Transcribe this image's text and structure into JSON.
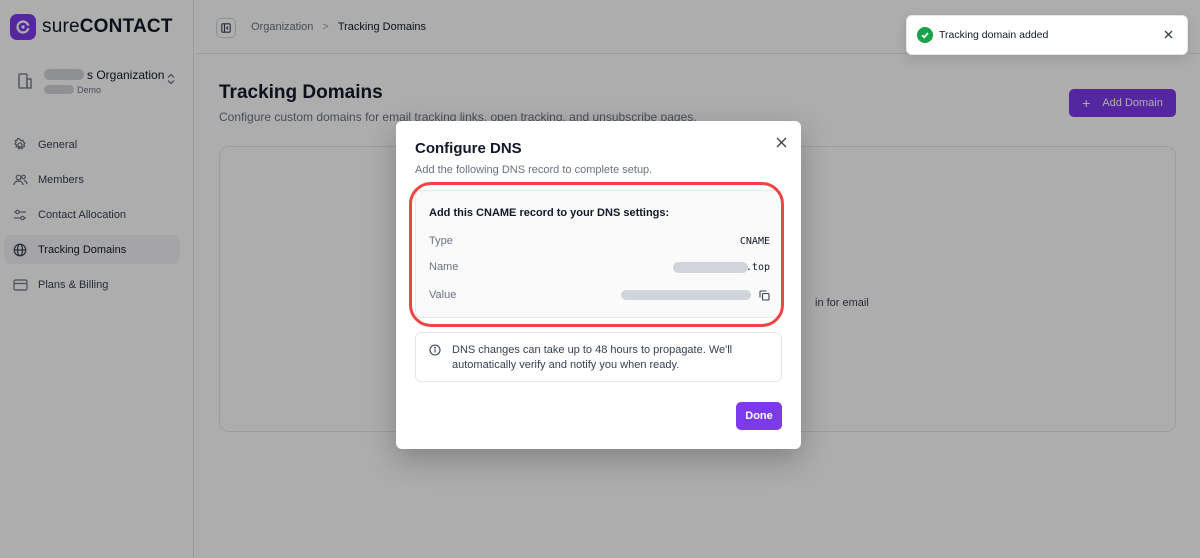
{
  "app": {
    "logo_text_light": "sure",
    "logo_text_bold": "CONTACT",
    "accent_color": "#7c3aed"
  },
  "sidebar": {
    "org_name_suffix": "s Organization",
    "org_subtitle_suffix": "Demo",
    "items": [
      {
        "label": "General",
        "icon": "gear-icon"
      },
      {
        "label": "Members",
        "icon": "users-icon"
      },
      {
        "label": "Contact Allocation",
        "icon": "sliders-icon"
      },
      {
        "label": "Tracking Domains",
        "icon": "globe-icon",
        "active": true
      },
      {
        "label": "Plans & Billing",
        "icon": "credit-card-icon"
      }
    ]
  },
  "topbar": {
    "breadcrumbs": [
      "Organization",
      "Tracking Domains"
    ],
    "separator": ">"
  },
  "page": {
    "title": "Tracking Domains",
    "subtitle": "Configure custom domains for email tracking links, open tracking, and unsubscribe pages.",
    "add_button_label": "Add Domain",
    "card_text_fragment": "in for email"
  },
  "toast": {
    "message": "Tracking domain added",
    "status_color": "#16a34a"
  },
  "modal": {
    "title": "Configure DNS",
    "subtitle": "Add the following DNS record to complete setup.",
    "record_heading": "Add this CNAME record to your DNS settings:",
    "rows": [
      {
        "label": "Type",
        "value": "CNAME"
      },
      {
        "label": "Name",
        "value": ".top"
      },
      {
        "label": "Value",
        "value": ""
      }
    ],
    "info_text": "DNS changes can take up to 48 hours to propagate. We'll automatically verify and notify you when ready.",
    "done_label": "Done",
    "highlight_color": "#ef4444"
  }
}
